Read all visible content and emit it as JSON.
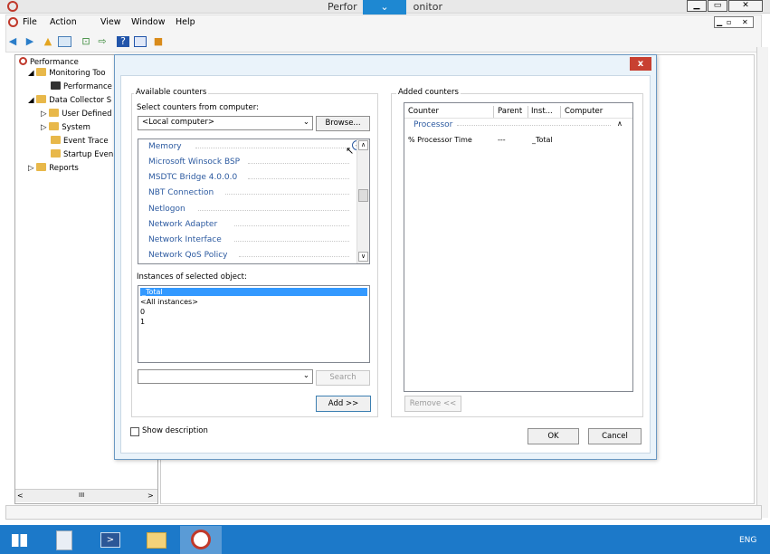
{
  "window": {
    "title_left": "Perfor",
    "title_right": "onitor",
    "tab_glyph": "⌄"
  },
  "menu": {
    "items": [
      "File",
      "Action",
      "View",
      "Window",
      "Help"
    ]
  },
  "tree": {
    "items": [
      {
        "label": "Performance"
      },
      {
        "label": "Monitoring Too"
      },
      {
        "label": "Performance"
      },
      {
        "label": "Data Collector S"
      },
      {
        "label": "User Defined"
      },
      {
        "label": "System"
      },
      {
        "label": "Event Trace"
      },
      {
        "label": "Startup Even"
      },
      {
        "label": "Reports"
      }
    ],
    "hscroll_thumb": "III"
  },
  "dialog": {
    "close_label": "x",
    "available_label": "Available counters",
    "select_from_label": "Select counters from computer:",
    "computer_value": "<Local computer>",
    "browse_label": "Browse...",
    "counters": [
      "Memory",
      "Microsoft Winsock BSP",
      "MSDTC Bridge 4.0.0.0",
      "NBT Connection",
      "Netlogon",
      "Network Adapter",
      "Network Interface",
      "Network QoS Policy"
    ],
    "instances_label": "Instances of selected object:",
    "instances": [
      "_Total",
      "<All instances>",
      "0",
      "1"
    ],
    "search_value": "",
    "search_label": "Search",
    "add_label": "Add >>",
    "added_label": "Added counters",
    "columns": [
      "Counter",
      "Parent",
      "Inst...",
      "Computer"
    ],
    "group_name": "Processor",
    "added_rows": [
      {
        "counter": "% Processor Time",
        "parent": "---",
        "instance": "_Total",
        "computer": ""
      }
    ],
    "remove_label": "Remove <<",
    "show_description_label": "Show description",
    "ok_label": "OK",
    "cancel_label": "Cancel"
  },
  "taskbar": {
    "lang": "ENG"
  },
  "colors": {
    "accent": "#1e88d2",
    "taskbar": "#1c79c9",
    "link_blue": "#2c5aa0",
    "selection": "#3399ff",
    "close_red": "#c84031"
  }
}
